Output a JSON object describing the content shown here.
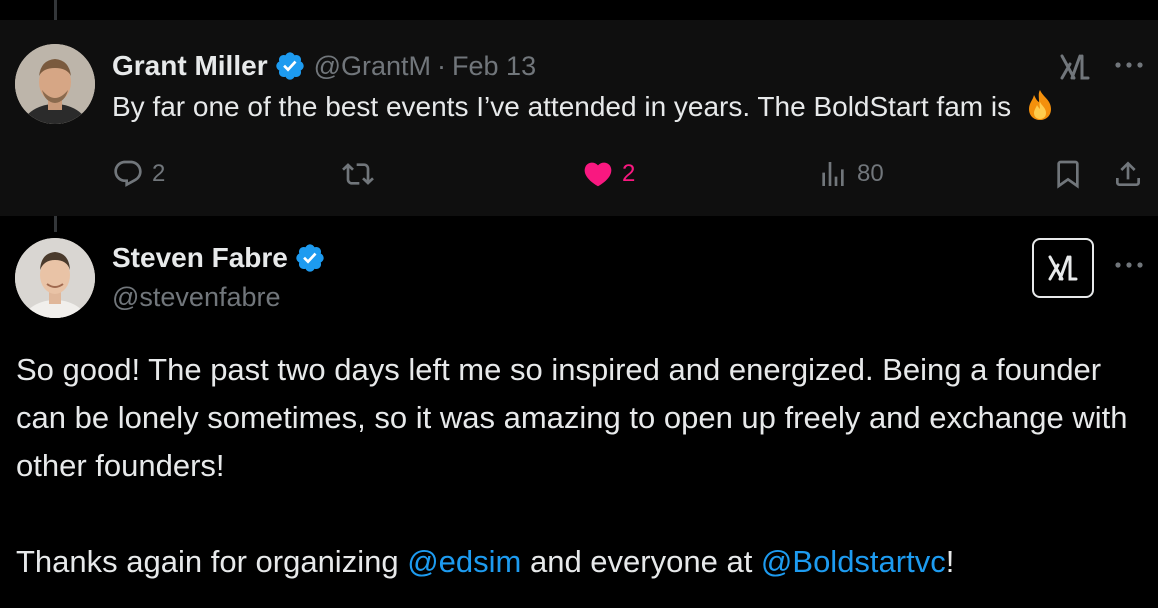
{
  "tweet_parent": {
    "author_name": "Grant Miller",
    "handle": "@GrantM",
    "separator": "·",
    "date": "Feb 13",
    "text": "By far one of the best events I’ve attended in years. The BoldStart fam is",
    "emoji": "fire-emoji",
    "actions": {
      "replies": "2",
      "reposts": "",
      "likes": "2",
      "views": "80"
    }
  },
  "tweet_reply": {
    "author_name": "Steven Fabre",
    "handle": "@stevenfabre",
    "paragraph1": "So good! The past two days left me so inspired and energized. Being a founder can be lonely sometimes, so it was amazing to open up freely and exchange with other founders!",
    "paragraph2": {
      "prefix": "Thanks again for organizing ",
      "mention1": "@edsim",
      "middle": " and everyone at ",
      "mention2": "@Boldstartvc",
      "suffix": "!"
    }
  },
  "colors": {
    "background": "#000000",
    "parent_background": "#0f0f0f",
    "text": "#e7e9ea",
    "muted": "#71767b",
    "accent_blue": "#1d9bf0",
    "like_pink": "#f91880"
  }
}
